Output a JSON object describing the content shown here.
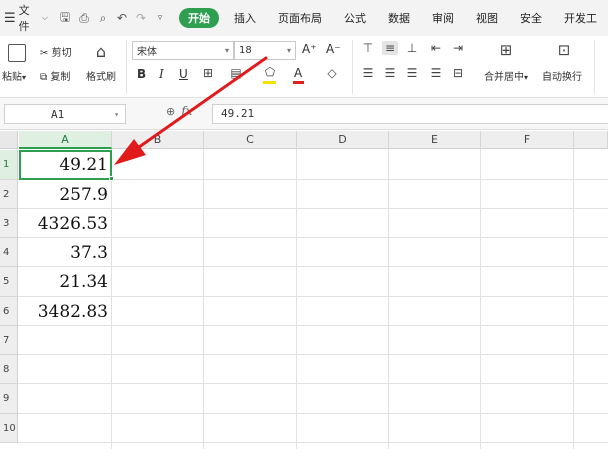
{
  "menubar": {
    "file_label": "文件",
    "tabs": [
      "开始",
      "插入",
      "页面布局",
      "公式",
      "数据",
      "审阅",
      "视图",
      "安全",
      "开发工"
    ],
    "active_tab": "开始"
  },
  "ribbon": {
    "paste_label": "粘贴",
    "cut_label": "剪切",
    "copy_label": "复制",
    "format_painter_label": "格式刷",
    "font_name": "宋体",
    "font_size": "18",
    "bold_label": "B",
    "italic_label": "I",
    "underline_label": "U",
    "font_color_label": "A",
    "grow_font_label": "A⁺",
    "shrink_font_label": "A⁻",
    "merge_center_label": "合并居中",
    "wrap_text_label": "自动换行",
    "accent_color": "#2e9e4f",
    "font_color_bar": "#e02020",
    "fill_color_bar": "#f5e000"
  },
  "formula_bar": {
    "name_box": "A1",
    "fx_label": "fx",
    "formula_value": "49.21"
  },
  "sheet": {
    "columns": [
      "A",
      "B",
      "C",
      "D",
      "E",
      "F"
    ],
    "rows": [
      "1",
      "2",
      "3",
      "4",
      "5",
      "6",
      "7",
      "8",
      "9",
      "10"
    ],
    "column_a_values": [
      "49.21",
      "257.9",
      "4326.53",
      "37.3",
      "21.34",
      "3482.83"
    ],
    "active_cell": "A1",
    "arrow_color": "#e11b1b"
  }
}
